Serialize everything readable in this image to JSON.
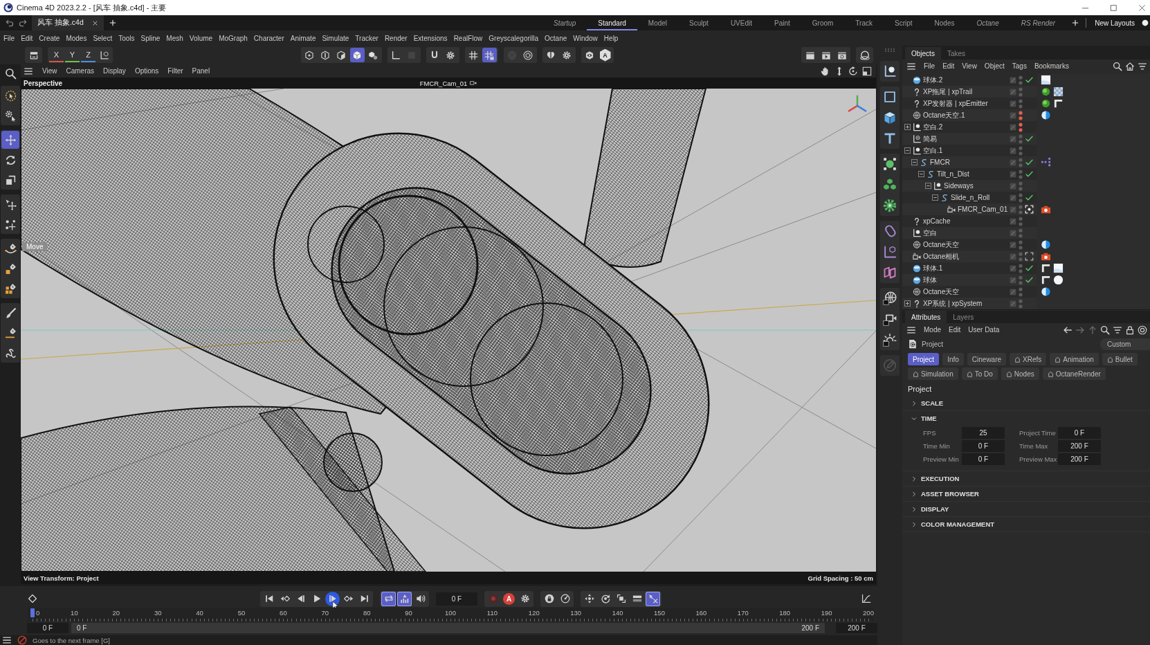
{
  "window": {
    "title": "Cinema 4D 2023.2.2 - [风车 抽象.c4d] - 主要"
  },
  "document_tabs": [
    {
      "label": "风车 抽象.c4d",
      "selected": true
    }
  ],
  "layouts": [
    {
      "label": "Startup",
      "kind": "custom",
      "selected": false
    },
    {
      "label": "Standard",
      "kind": "builtin",
      "selected": true
    },
    {
      "label": "Model",
      "kind": "builtin",
      "selected": false
    },
    {
      "label": "Sculpt",
      "kind": "builtin",
      "selected": false
    },
    {
      "label": "UVEdit",
      "kind": "builtin",
      "selected": false
    },
    {
      "label": "Paint",
      "kind": "builtin",
      "selected": false
    },
    {
      "label": "Groom",
      "kind": "builtin",
      "selected": false
    },
    {
      "label": "Track",
      "kind": "builtin",
      "selected": false
    },
    {
      "label": "Script",
      "kind": "builtin",
      "selected": false
    },
    {
      "label": "Nodes",
      "kind": "builtin",
      "selected": false
    },
    {
      "label": "Octane",
      "kind": "custom",
      "selected": false
    },
    {
      "label": "RS Render",
      "kind": "custom",
      "selected": false
    }
  ],
  "new_layouts": "New Layouts",
  "menu": [
    "File",
    "Edit",
    "Create",
    "Modes",
    "Select",
    "Tools",
    "Spline",
    "Mesh",
    "Volume",
    "MoGraph",
    "Character",
    "Animate",
    "Simulate",
    "Tracker",
    "Render",
    "Extensions",
    "RealFlow",
    "Greyscalegorilla",
    "Octane",
    "Window",
    "Help"
  ],
  "toolbar": {
    "axes": [
      {
        "label": "X",
        "color": "#d9534f"
      },
      {
        "label": "Y",
        "color": "#6fbf4f"
      },
      {
        "label": "Z",
        "color": "#4f8fdf"
      }
    ],
    "groups": [
      [
        {
          "kind": "hex-dot",
          "selected": false,
          "disabled": false
        },
        {
          "kind": "hex-edge",
          "selected": false,
          "disabled": false
        },
        {
          "kind": "cube-half",
          "selected": false,
          "disabled": false
        },
        {
          "kind": "cube-solid",
          "selected": true,
          "disabled": false
        },
        {
          "kind": "cube-pieces",
          "selected": false,
          "disabled": false
        }
      ],
      [
        {
          "kind": "axis-corner",
          "selected": false,
          "disabled": false
        },
        {
          "kind": "square",
          "selected": false,
          "disabled": true
        }
      ],
      [
        {
          "kind": "magnet",
          "selected": false,
          "disabled": false
        },
        {
          "kind": "gear",
          "selected": false,
          "disabled": false
        }
      ],
      [
        {
          "kind": "grid",
          "selected": false,
          "disabled": false
        },
        {
          "kind": "grid-lock",
          "selected": true,
          "disabled": false
        }
      ],
      [
        {
          "kind": "rings",
          "selected": false,
          "disabled": true
        },
        {
          "kind": "gear-ring",
          "selected": false,
          "disabled": false
        }
      ],
      [
        {
          "kind": "butterfly",
          "selected": false,
          "disabled": false
        },
        {
          "kind": "gear",
          "selected": false,
          "disabled": false
        }
      ],
      [
        {
          "kind": "eye-hex",
          "selected": false,
          "disabled": false
        },
        {
          "kind": "hex-letter",
          "label": "A",
          "selected": false,
          "disabled": false
        }
      ]
    ]
  },
  "tools": [
    [
      {
        "kind": "select-circle",
        "selected": false
      },
      {
        "kind": "gear-arrow",
        "selected": false
      }
    ],
    [
      {
        "kind": "move",
        "selected": true
      },
      {
        "kind": "rotate",
        "selected": false
      },
      {
        "kind": "scale",
        "selected": false
      }
    ],
    [
      {
        "kind": "point-move",
        "selected": false
      },
      {
        "kind": "scatter-move",
        "selected": false
      }
    ],
    [
      {
        "kind": "pen-arc",
        "selected": false
      },
      {
        "kind": "pen-square",
        "selected": false
      },
      {
        "kind": "pen-cubes",
        "selected": false
      }
    ],
    [
      {
        "kind": "brush",
        "selected": false
      },
      {
        "kind": "pen-line",
        "selected": false
      },
      {
        "kind": "squiggle",
        "selected": false
      }
    ]
  ],
  "viewport": {
    "menu": [
      "View",
      "Cameras",
      "Display",
      "Options",
      "Filter",
      "Panel"
    ],
    "view_name": "Perspective",
    "camera": "FMCR_Cam_01",
    "hud_label": "Move",
    "view_transform": "View Transform: Project",
    "grid_spacing": "Grid Spacing : 50 cm"
  },
  "objects": {
    "tabs": [
      {
        "label": "Objects",
        "selected": true
      },
      {
        "label": "Takes",
        "selected": false
      }
    ],
    "menu": [
      "File",
      "Edit",
      "View",
      "Object",
      "Tags",
      "Bookmarks"
    ],
    "rows": [
      {
        "name": "球体.2",
        "kind": "sphere",
        "enabled": true,
        "hidden": false,
        "selected": false,
        "tags": [
          {
            "kind": "swatch-white"
          }
        ]
      },
      {
        "name": "XP拖尾 | xpTrail",
        "kind": "question",
        "enabled": false,
        "hidden": false,
        "selected": false,
        "tags": [
          {
            "kind": "ball-green"
          },
          {
            "kind": "swatch-checker"
          }
        ]
      },
      {
        "name": "XP发射器 | xpEmitter",
        "kind": "question",
        "enabled": false,
        "hidden": false,
        "selected": false,
        "tags": [
          {
            "kind": "ball-green"
          },
          {
            "kind": "corner"
          }
        ]
      },
      {
        "name": "Octane天空.1",
        "kind": "sky",
        "enabled": false,
        "hidden": true,
        "selected": false,
        "tags": [
          {
            "kind": "half-disc"
          }
        ]
      },
      {
        "name": "空白.2",
        "kind": "null",
        "enabled": false,
        "hidden": true,
        "selected": false,
        "expanded": false
      },
      {
        "name": "简易",
        "kind": "null-dot",
        "enabled": true,
        "hidden": false,
        "selected": false
      },
      {
        "name": "空白.1",
        "kind": "null",
        "enabled": false,
        "hidden": false,
        "selected": false,
        "expanded": true,
        "children": [
          {
            "name": "FMCR",
            "kind": "spline-s",
            "enabled": true,
            "hidden": false,
            "selected": false,
            "expanded": true,
            "tags": [
              {
                "kind": "nodes-purple"
              }
            ],
            "children": [
              {
                "name": "Tilt_n_Dist",
                "kind": "spline-s",
                "enabled": true,
                "hidden": false,
                "selected": false,
                "expanded": true,
                "children": [
                  {
                    "name": "Sideways",
                    "kind": "null",
                    "enabled": false,
                    "hidden": false,
                    "selected": false,
                    "expanded": true,
                    "children": [
                      {
                        "name": "Slide_n_Roll",
                        "kind": "spline-s",
                        "enabled": true,
                        "hidden": false,
                        "selected": false,
                        "expanded": true,
                        "children": [
                          {
                            "name": "FMCR_Cam_01",
                            "kind": "camera",
                            "enabled": true,
                            "hidden": false,
                            "selected": false,
                            "tags": [
                              {
                                "kind": "camera-red"
                              }
                            ]
                          }
                        ]
                      }
                    ]
                  }
                ]
              }
            ]
          }
        ]
      },
      {
        "name": "xpCache",
        "kind": "question",
        "enabled": false,
        "hidden": false,
        "selected": false
      },
      {
        "name": "空白",
        "kind": "null",
        "enabled": false,
        "hidden": false,
        "selected": false
      },
      {
        "name": "Octane天空",
        "kind": "sky",
        "enabled": false,
        "hidden": false,
        "selected": false,
        "tags": [
          {
            "kind": "half-disc"
          }
        ]
      },
      {
        "name": "Octane相机",
        "kind": "camera",
        "enabled": false,
        "hidden": false,
        "selected": false,
        "tags": [
          {
            "kind": "camera-red"
          }
        ]
      },
      {
        "name": "球体.1",
        "kind": "sphere",
        "enabled": true,
        "hidden": false,
        "selected": false,
        "tags": [
          {
            "kind": "corner"
          },
          {
            "kind": "swatch-white"
          }
        ]
      },
      {
        "name": "球体",
        "kind": "sphere",
        "enabled": true,
        "hidden": false,
        "selected": false,
        "tags": [
          {
            "kind": "corner"
          },
          {
            "kind": "swatch-round"
          }
        ]
      },
      {
        "name": "Octane天空",
        "kind": "sky",
        "enabled": false,
        "hidden": false,
        "selected": false,
        "tags": [
          {
            "kind": "half-disc"
          }
        ]
      },
      {
        "name": "XP系统 | xpSystem",
        "kind": "question",
        "enabled": false,
        "hidden": false,
        "selected": false,
        "expanded": false
      }
    ]
  },
  "attributes": {
    "tabs": [
      {
        "label": "Attributes",
        "selected": true
      },
      {
        "label": "Layers",
        "selected": false
      }
    ],
    "menu": [
      "Mode",
      "Edit",
      "User Data"
    ],
    "object": "Project",
    "preset": "Custom",
    "pages": [
      {
        "label": "Project",
        "kind": "plain",
        "selected": true
      },
      {
        "label": "Info",
        "kind": "plain",
        "selected": false
      },
      {
        "label": "Cineware",
        "kind": "plain",
        "selected": false
      },
      {
        "label": "XRefs",
        "kind": "marked",
        "selected": false
      },
      {
        "label": "Animation",
        "kind": "marked",
        "selected": false
      },
      {
        "label": "Bullet",
        "kind": "marked",
        "selected": false
      },
      {
        "label": "Simulation",
        "kind": "marked",
        "selected": false
      },
      {
        "label": "To Do",
        "kind": "marked",
        "selected": false
      },
      {
        "label": "Nodes",
        "kind": "marked",
        "selected": false
      },
      {
        "label": "OctaneRender",
        "kind": "marked",
        "selected": false
      }
    ],
    "section": "Project",
    "groups": [
      {
        "label": "SCALE",
        "expanded": false
      },
      {
        "label": "TIME",
        "expanded": true,
        "fields": [
          {
            "label": "FPS",
            "value": "25"
          },
          {
            "label": "Project Time",
            "value": "0 F"
          },
          {
            "label": "Time Min",
            "value": "0 F"
          },
          {
            "label": "Time Max",
            "value": "200 F"
          },
          {
            "label": "Preview Min",
            "value": "0 F"
          },
          {
            "label": "Preview Max",
            "value": "200 F"
          }
        ]
      },
      {
        "label": "EXECUTION",
        "expanded": false
      },
      {
        "label": "ASSET BROWSER",
        "expanded": false
      },
      {
        "label": "DISPLAY",
        "expanded": false
      },
      {
        "label": "COLOR MANAGEMENT",
        "expanded": false
      }
    ]
  },
  "timeline": {
    "transport": [
      [
        {
          "kind": "skip-start",
          "selected": false,
          "pressed": false
        },
        {
          "kind": "prev-key",
          "selected": false,
          "pressed": false
        },
        {
          "kind": "step-back",
          "selected": false,
          "pressed": false
        },
        {
          "kind": "play",
          "selected": false,
          "pressed": false
        },
        {
          "kind": "step-forward",
          "selected": false,
          "pressed": true
        },
        {
          "kind": "next-key",
          "selected": false,
          "pressed": false
        },
        {
          "kind": "skip-end",
          "selected": false,
          "pressed": false
        }
      ],
      [
        {
          "kind": "loop",
          "selected": true,
          "pressed": false
        },
        {
          "kind": "bars",
          "selected": true,
          "pressed": false
        },
        {
          "kind": "speaker",
          "selected": false,
          "pressed": false
        }
      ],
      [
        {
          "kind": "record",
          "selected": false,
          "pressed": false
        },
        {
          "kind": "auto-key",
          "label": "A",
          "selected": false,
          "pressed": false
        },
        {
          "kind": "gear",
          "selected": false,
          "pressed": false
        }
      ],
      [
        {
          "kind": "mouse-lock",
          "selected": false,
          "pressed": false
        },
        {
          "kind": "dial",
          "selected": false,
          "pressed": false
        }
      ],
      [
        {
          "kind": "move-key",
          "selected": false,
          "pressed": false
        },
        {
          "kind": "rotate-key",
          "selected": false,
          "pressed": false
        },
        {
          "kind": "scale-key",
          "selected": false,
          "pressed": false
        },
        {
          "kind": "toggle",
          "selected": false,
          "pressed": false
        },
        {
          "kind": "point-cross",
          "selected": true,
          "pressed": false
        }
      ]
    ],
    "current_frame": "0 F",
    "ruler": {
      "labels": [
        "0",
        "10",
        "20",
        "30",
        "40",
        "50",
        "60",
        "70",
        "80",
        "90",
        "100",
        "110",
        "120",
        "130",
        "140",
        "150",
        "160",
        "170",
        "180",
        "190",
        "200"
      ],
      "level": 0
    },
    "range": {
      "start": "0 F",
      "from": "0 F",
      "to": "200 F",
      "end": "200 F",
      "level": 1
    }
  },
  "status_bar": {
    "text": "Goes to the next frame [G]"
  }
}
